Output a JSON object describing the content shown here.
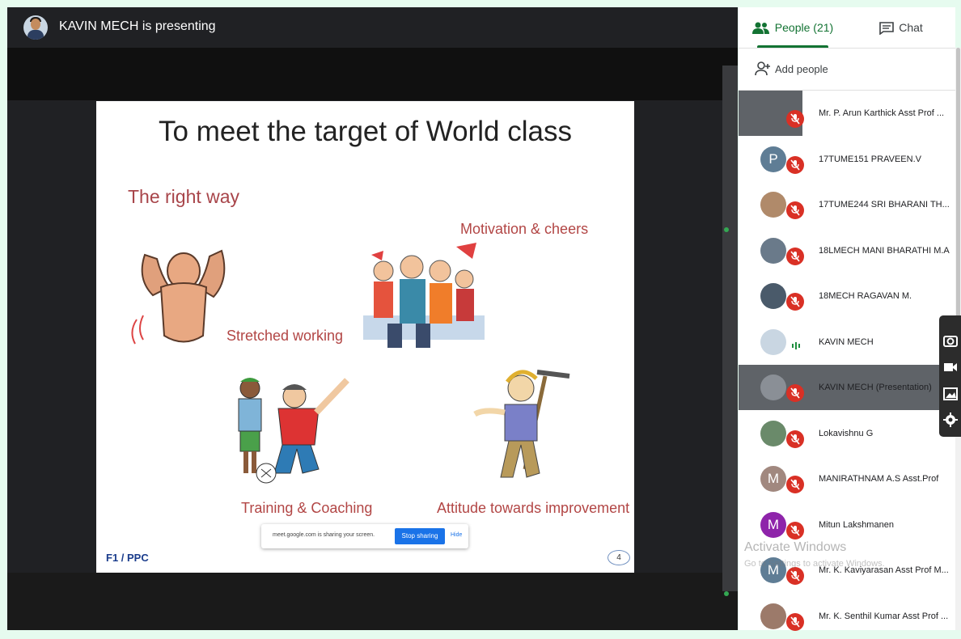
{
  "presenter": {
    "title": "KAVIN MECH is presenting"
  },
  "slide": {
    "title": "To meet the target of World class",
    "labels": {
      "right_way": "The right way",
      "motivation": "Motivation & cheers",
      "stretched": "Stretched working",
      "training": "Training & Coaching",
      "attitude": "Attitude towards improvement"
    },
    "footer": "F1 / PPC",
    "page_number": "4"
  },
  "share_bar": {
    "message": "meet.google.com is sharing your screen.",
    "stop_label": "Stop sharing",
    "hide_label": "Hide"
  },
  "panel": {
    "tabs": {
      "people": "People (21)",
      "chat": "Chat"
    },
    "add_people": "Add people",
    "participants": [
      {
        "name": "Mr. P. Arun Karthick Asst Prof ...",
        "initial": ""
      },
      {
        "name": "17TUME151 PRAVEEN.V",
        "initial": "P"
      },
      {
        "name": "17TUME244 SRI BHARANI TH...",
        "initial": ""
      },
      {
        "name": "18LMECH MANI BHARATHI M.A",
        "initial": ""
      },
      {
        "name": "18MECH RAGAVAN M.",
        "initial": ""
      },
      {
        "name": "KAVIN MECH",
        "initial": ""
      },
      {
        "name": "KAVIN MECH (Presentation)",
        "initial": ""
      },
      {
        "name": "Lokavishnu G",
        "initial": ""
      },
      {
        "name": "MANIRATHNAM A.S Asst.Prof",
        "initial": "M"
      },
      {
        "name": "Mitun Lakshmanen",
        "initial": "M"
      },
      {
        "name": "Mr. K. Kaviyarasan Asst Prof M...",
        "initial": "M"
      },
      {
        "name": "Mr. K. Senthil Kumar Asst Prof ...",
        "initial": ""
      }
    ]
  },
  "watermark": {
    "title": "Activate Windows",
    "subtitle": "Go to Settings to activate Windows."
  },
  "colors": {
    "accent_green": "#137333",
    "mute_red": "#d93025",
    "stage_bg": "#202124",
    "share_blue": "#1a73e8"
  },
  "icons": [
    "people-icon",
    "chat-icon",
    "add-person-icon",
    "mic-off-icon",
    "camera-icon",
    "video-icon",
    "image-icon",
    "gear-icon"
  ]
}
